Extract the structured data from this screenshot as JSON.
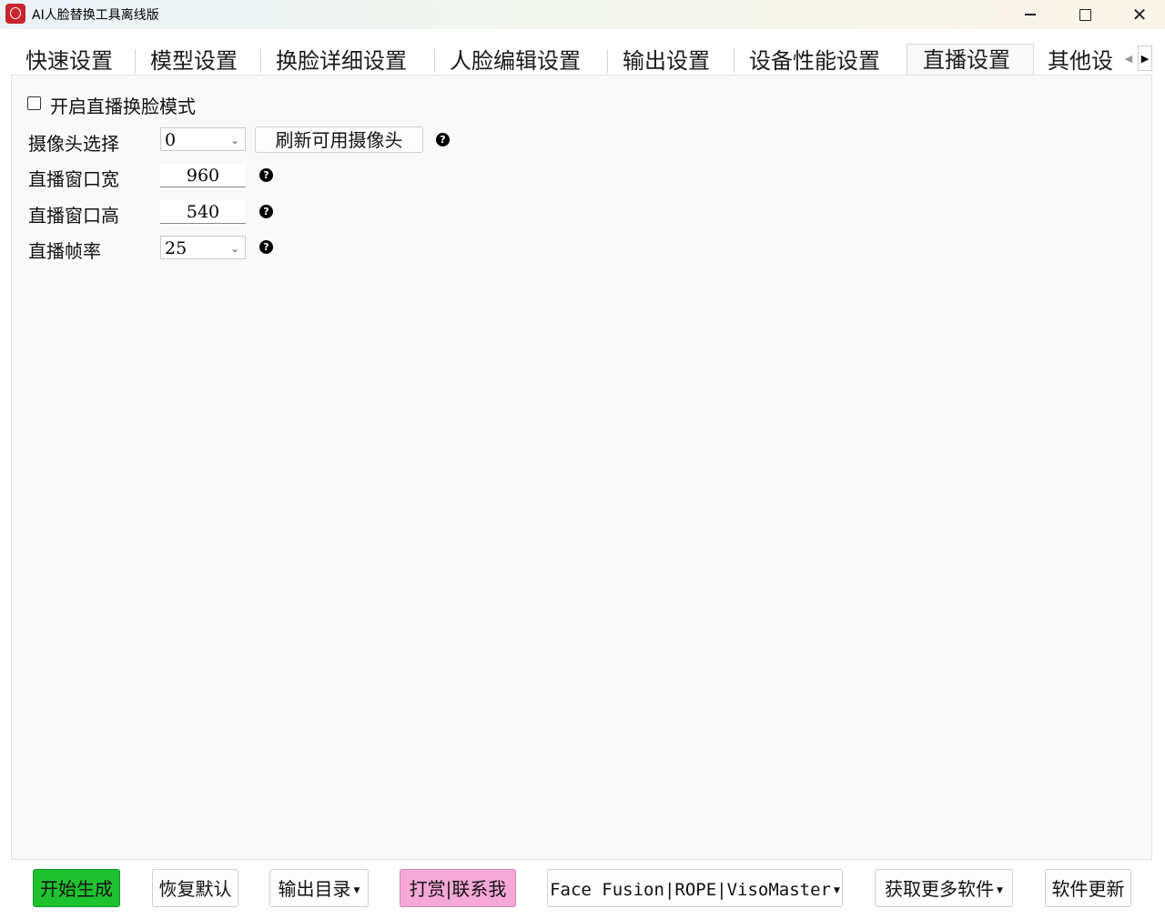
{
  "window": {
    "title": "AI人脸替换工具离线版",
    "close_glyph": "✕"
  },
  "tabs": [
    {
      "label": "快速设置",
      "active": false
    },
    {
      "label": "模型设置",
      "active": false
    },
    {
      "label": "换脸详细设置",
      "active": false
    },
    {
      "label": "人脸编辑设置",
      "active": false
    },
    {
      "label": "输出设置",
      "active": false
    },
    {
      "label": "设备性能设置",
      "active": false
    },
    {
      "label": "直播设置",
      "active": true
    },
    {
      "label": "其他设",
      "active": false
    }
  ],
  "tab_scroll": {
    "left_glyph": "◀",
    "right_glyph": "▶"
  },
  "live": {
    "enable_label": "开启直播换脸模式",
    "enable_checked": false,
    "camera_label": "摄像头选择",
    "camera_value": "0",
    "refresh_button": "刷新可用摄像头",
    "width_label": "直播窗口宽",
    "width_value": "960",
    "height_label": "直播窗口高",
    "height_value": "540",
    "fps_label": "直播帧率",
    "fps_value": "25",
    "help_glyph": "?",
    "chevron_glyph": "⌄"
  },
  "footer": {
    "start": "开始生成",
    "reset": "恢复默认",
    "output_dir": "输出目录",
    "donate": "打赏|联系我",
    "links": "Face Fusion|ROPE|VisoMaster",
    "more_software": "获取更多软件",
    "update": "软件更新",
    "caret_glyph": "▼"
  },
  "colors": {
    "start_bg": "#1ec12f",
    "donate_bg": "#f6a8d7"
  }
}
